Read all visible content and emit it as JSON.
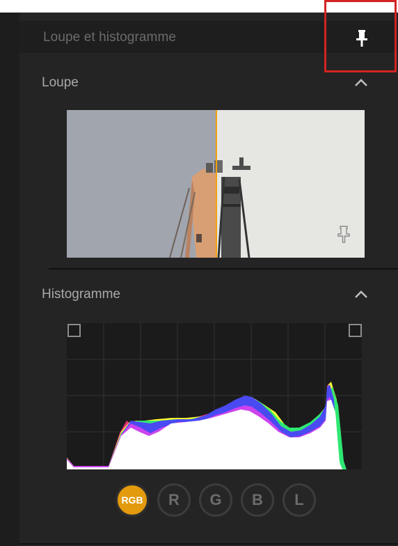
{
  "panel": {
    "title": "Loupe et histogramme",
    "pin_icon": "pin-icon"
  },
  "loupe": {
    "title": "Loupe",
    "collapse_icon": "chevron-up-icon",
    "overlay_pin_icon": "pin-outline-icon"
  },
  "histogram": {
    "title": "Histogramme",
    "collapse_icon": "chevron-up-icon",
    "shadow_clip_icon": "clipping-square-icon",
    "highlight_clip_icon": "clipping-square-icon",
    "channels": [
      {
        "label": "RGB",
        "active": true
      },
      {
        "label": "R",
        "active": false
      },
      {
        "label": "G",
        "active": false
      },
      {
        "label": "B",
        "active": false
      },
      {
        "label": "L",
        "active": false
      }
    ]
  },
  "colors": {
    "accent": "#e39a0c",
    "highlight_box": "#d42323"
  }
}
